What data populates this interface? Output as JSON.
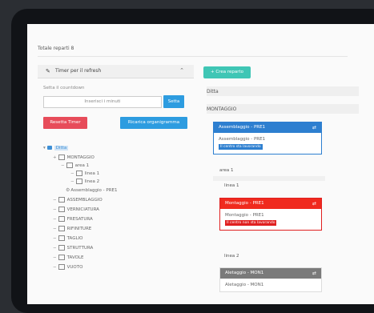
{
  "header": {
    "totale": "Totale reparti 8"
  },
  "timer_panel": {
    "title": "Timer per il refresh",
    "set_label": "Setta il countdown",
    "input_value": "Inserisci i minuti",
    "set_button": "Setta"
  },
  "buttons": {
    "reset": "Resetta Timer",
    "reload": "Ricarica organigramma",
    "create": "+ Crea reparto"
  },
  "tree": {
    "root": "Ditta",
    "nodes": [
      {
        "prefix": "+",
        "label": "MONTAGGIO"
      },
      {
        "prefix": "−",
        "label": "area 1"
      },
      {
        "prefix": "−",
        "label": "linea 1"
      },
      {
        "prefix": "−",
        "label": "linea 2"
      },
      {
        "prefix": "",
        "label": "Assemblaggio - PRE1"
      },
      {
        "prefix": "−",
        "label": "ASSEMBLAGGIO"
      },
      {
        "prefix": "−",
        "label": "VERNICIATURA"
      },
      {
        "prefix": "−",
        "label": "FRESATURA"
      },
      {
        "prefix": "−",
        "label": "RIFINITURE"
      },
      {
        "prefix": "−",
        "label": "TAGLIO"
      },
      {
        "prefix": "−",
        "label": "STRUTTURA"
      },
      {
        "prefix": "−",
        "label": "TAVOLE"
      },
      {
        "prefix": "−",
        "label": "VUOTO"
      }
    ]
  },
  "org": {
    "root": "Ditta",
    "dept": "MONTAGGIO",
    "area": "area 1",
    "line1": "linea 1",
    "line2": "linea 2",
    "cards": {
      "blue": {
        "title": "Assemblaggio - PRE1",
        "line": "Assemblaggio - PRE1",
        "badge": "Il centro sta lavorando"
      },
      "red": {
        "title": "Montaggio - PRE1",
        "line": "Montaggio - PRE1",
        "badge": "Il centro non sta lavorando"
      },
      "gray": {
        "title": "Aletaggio - MON1",
        "line": "Aletaggio - MON1"
      }
    }
  },
  "colors": {
    "blue": "#2d7fd0",
    "red": "#f02a1e",
    "teal": "#3fc6b5",
    "reset": "#e74c5a"
  }
}
